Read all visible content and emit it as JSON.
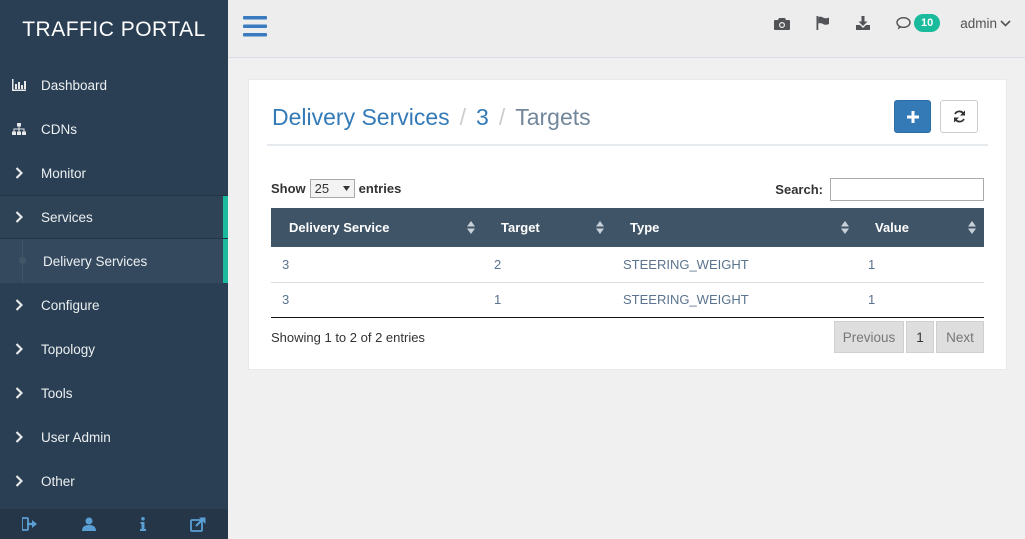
{
  "brand": "TRAFFIC PORTAL",
  "sidebar": {
    "items": [
      {
        "label": "Dashboard",
        "icon": "bar-chart-icon"
      },
      {
        "label": "CDNs",
        "icon": "sitemap-icon"
      },
      {
        "label": "Monitor",
        "icon": "chevron-right-icon"
      },
      {
        "label": "Services",
        "icon": "chevron-right-icon"
      },
      {
        "label": "Delivery Services",
        "icon": "sub-item-dot"
      },
      {
        "label": "Configure",
        "icon": "chevron-right-icon"
      },
      {
        "label": "Topology",
        "icon": "chevron-right-icon"
      },
      {
        "label": "Tools",
        "icon": "chevron-right-icon"
      },
      {
        "label": "User Admin",
        "icon": "chevron-right-icon"
      },
      {
        "label": "Other",
        "icon": "chevron-right-icon"
      }
    ],
    "footer_icons": [
      "logout-icon",
      "user-icon",
      "info-icon",
      "external-link-icon"
    ]
  },
  "topbar": {
    "icons": [
      "camera-icon",
      "flag-icon",
      "download-icon",
      "comment-icon"
    ],
    "notification_count": "10",
    "user": "admin"
  },
  "breadcrumb": {
    "parent": "Delivery Services",
    "sep1": "/",
    "id": "3",
    "sep2": "/",
    "current": "Targets"
  },
  "table_controls": {
    "show_label": "Show",
    "page_size": "25",
    "entries_label": "entries",
    "search_label": "Search:",
    "search_value": ""
  },
  "table": {
    "headers": [
      "Delivery Service",
      "Target",
      "Type",
      "Value"
    ],
    "rows": [
      [
        "3",
        "2",
        "STEERING_WEIGHT",
        "1"
      ],
      [
        "3",
        "1",
        "STEERING_WEIGHT",
        "1"
      ]
    ]
  },
  "footer": {
    "info": "Showing 1 to 2 of 2 entries",
    "previous": "Previous",
    "page": "1",
    "next": "Next"
  },
  "colors": {
    "sidebar_bg": "#2a3f54",
    "accent": "#1abb9c",
    "primary": "#337ab7",
    "table_header": "#405467"
  }
}
